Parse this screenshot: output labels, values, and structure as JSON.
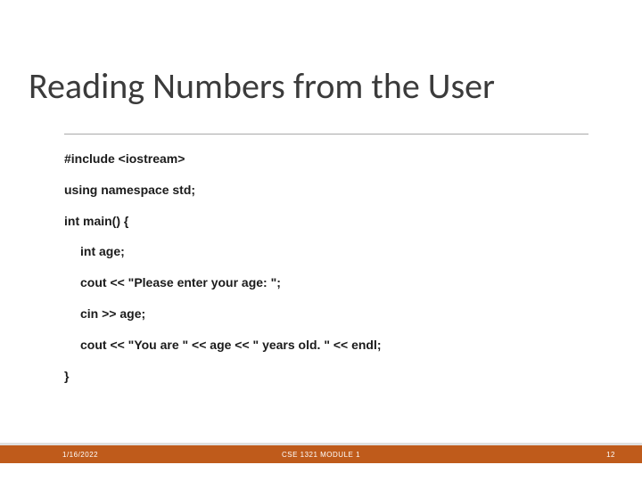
{
  "title": "Reading Numbers from the User",
  "code": {
    "l0": "#include <iostream>",
    "l1": "using namespace std;",
    "l2": "int main() {",
    "l3": "int age;",
    "l4": "cout << \"Please enter your age: \";",
    "l5": "cin >> age;",
    "l6": "cout << \"You are \" << age << \" years old. \" << endl;",
    "l7": "}"
  },
  "footer": {
    "date": "1/16/2022",
    "center": "CSE 1321 MODULE 1",
    "page": "12"
  }
}
